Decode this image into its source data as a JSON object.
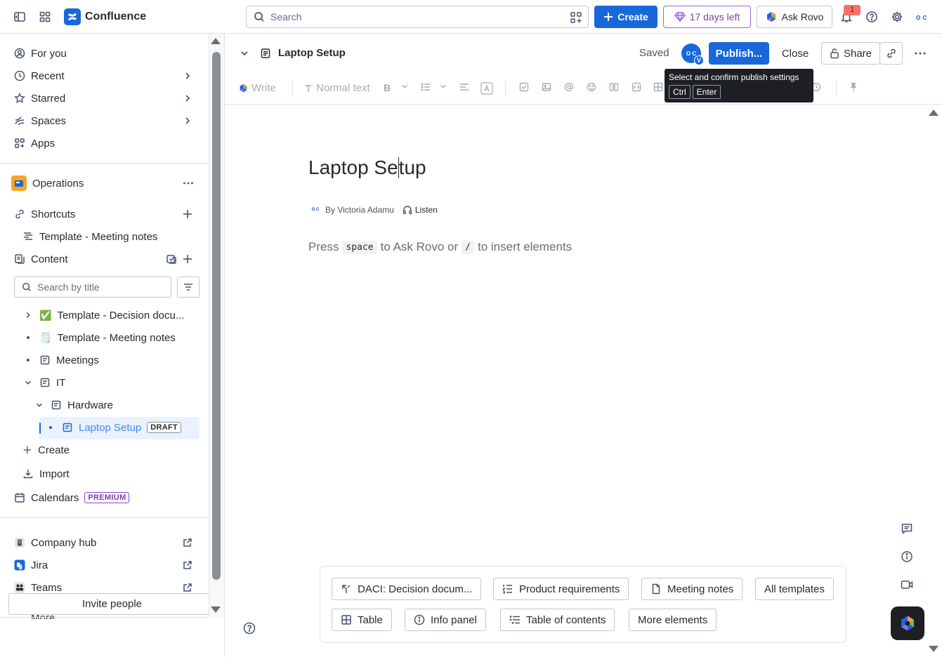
{
  "topbar": {
    "app_name": "Confluence",
    "search_placeholder": "Search",
    "create_label": "Create",
    "trial_label": "17 days left",
    "rovo_label": "Ask Rovo",
    "notification_count": "1",
    "profile_initials": "O C"
  },
  "sidebar": {
    "nav": [
      {
        "label": "For you",
        "icon": "user-circle-icon"
      },
      {
        "label": "Recent",
        "icon": "clock-icon"
      },
      {
        "label": "Starred",
        "icon": "star-icon"
      },
      {
        "label": "Spaces",
        "icon": "spaces-icon"
      },
      {
        "label": "Apps",
        "icon": "apps-icon"
      }
    ],
    "space_name": "Operations",
    "shortcuts_label": "Shortcuts",
    "shortcut_item": "Template - Meeting notes",
    "content_label": "Content",
    "title_search_placeholder": "Search by title",
    "tree": [
      {
        "label": "Template - Decision docu...",
        "emoji": "✅"
      },
      {
        "label": "Template - Meeting notes",
        "emoji": "🗒️"
      },
      {
        "label": "Meetings"
      },
      {
        "label": "IT"
      },
      {
        "label": "Hardware"
      },
      {
        "label": "Laptop Setup",
        "badge": "DRAFT"
      }
    ],
    "create_label": "Create",
    "import_label": "Import",
    "calendars_label": "Calendars",
    "calendars_badge": "PREMIUM",
    "links": [
      {
        "label": "Company hub"
      },
      {
        "label": "Jira"
      },
      {
        "label": "Teams"
      }
    ],
    "more_label": "More",
    "invite_label": "Invite people"
  },
  "editor": {
    "page_title": "Laptop Setup",
    "saved_label": "Saved",
    "collab_initials": "O C",
    "collab_badge": "V",
    "publish_label": "Publish...",
    "close_label": "Close",
    "share_label": "Share",
    "toolbar": {
      "write_label": "Write",
      "text_style": "Normal text"
    },
    "tooltip": {
      "text": "Select and confirm publish settings",
      "key1": "Ctrl",
      "key2": "Enter"
    },
    "doc_title_before_caret": "Laptop Se",
    "doc_title_after_caret": "tup",
    "byline_author": "By Victoria Adamu",
    "listen_label": "Listen",
    "byline_initials": "O C",
    "placeholder": {
      "part1": "Press",
      "key1": "space",
      "part2": "to Ask Rovo or",
      "key2": "/",
      "part3": "to insert elements"
    },
    "templates": [
      {
        "label": "DACI: Decision docum...",
        "icon": "daci-icon"
      },
      {
        "label": "Product requirements",
        "icon": "requirements-icon"
      },
      {
        "label": "Meeting notes",
        "icon": "page-icon"
      },
      {
        "label": "All templates"
      }
    ],
    "elements": [
      {
        "label": "Table",
        "icon": "table-icon"
      },
      {
        "label": "Info panel",
        "icon": "info-icon"
      },
      {
        "label": "Table of contents",
        "icon": "toc-icon"
      },
      {
        "label": "More elements"
      }
    ]
  }
}
